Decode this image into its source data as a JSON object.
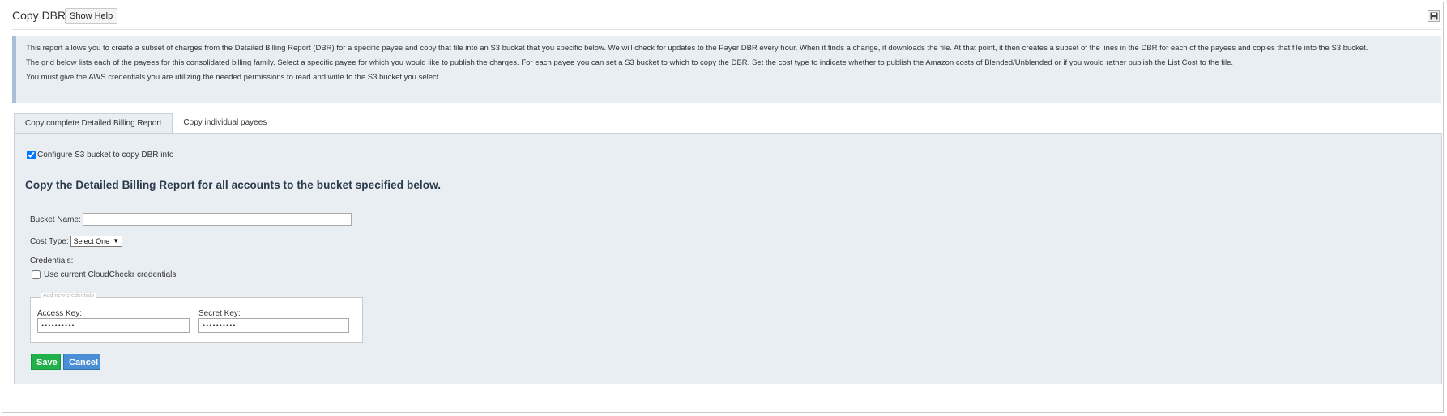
{
  "header": {
    "title": "Copy DBR",
    "show_help_label": "Show Help",
    "save_icon": "floppy-disk-icon"
  },
  "info": {
    "paragraphs": [
      "This report allows you to create a subset of charges from the Detailed Billing Report (DBR) for a specific payee and copy that file into an S3 bucket that you specific below. We will check for updates to the Payer DBR every hour. When it finds a change, it downloads the file. At that point, it then creates a subset of the lines in the DBR for each of the payees and copies that file into the S3 bucket.",
      "The grid below lists each of the payees for this consolidated billing family. Select a specific payee for which you would like to publish the charges. For each payee you can set a S3 bucket to which to copy the DBR. Set the cost type to indicate whether to publish the Amazon costs of Blended/Unblended or if you would rather publish the List Cost to the file.",
      "You must give the AWS credentials you are utilizing the needed permissions to read and write to the S3 bucket you select."
    ]
  },
  "tabs": [
    {
      "label": "Copy complete Detailed Billing Report",
      "active": true
    },
    {
      "label": "Copy individual payees",
      "active": false
    }
  ],
  "form": {
    "configure_label": "Configure S3 bucket to copy DBR into",
    "configure_checked": true,
    "heading": "Copy the Detailed Billing Report for all accounts to the bucket specified below.",
    "bucket_label": "Bucket Name:",
    "bucket_value": "",
    "cost_type_label": "Cost Type:",
    "cost_type_selected": "Select One",
    "credentials_label": "Credentials:",
    "use_current_label": "Use current CloudCheckr credentials",
    "use_current_checked": false,
    "fieldset_legend": "Add new credentials",
    "access_key_label": "Access Key:",
    "access_key_value": "••••••••••",
    "secret_key_label": "Secret Key:",
    "secret_key_value": "••••••••••",
    "save_label": "Save",
    "cancel_label": "Cancel"
  },
  "colors": {
    "save": "#21b14a",
    "cancel": "#4a8fd6",
    "panel": "#e9eef3",
    "info_border": "#a9bfd8"
  }
}
